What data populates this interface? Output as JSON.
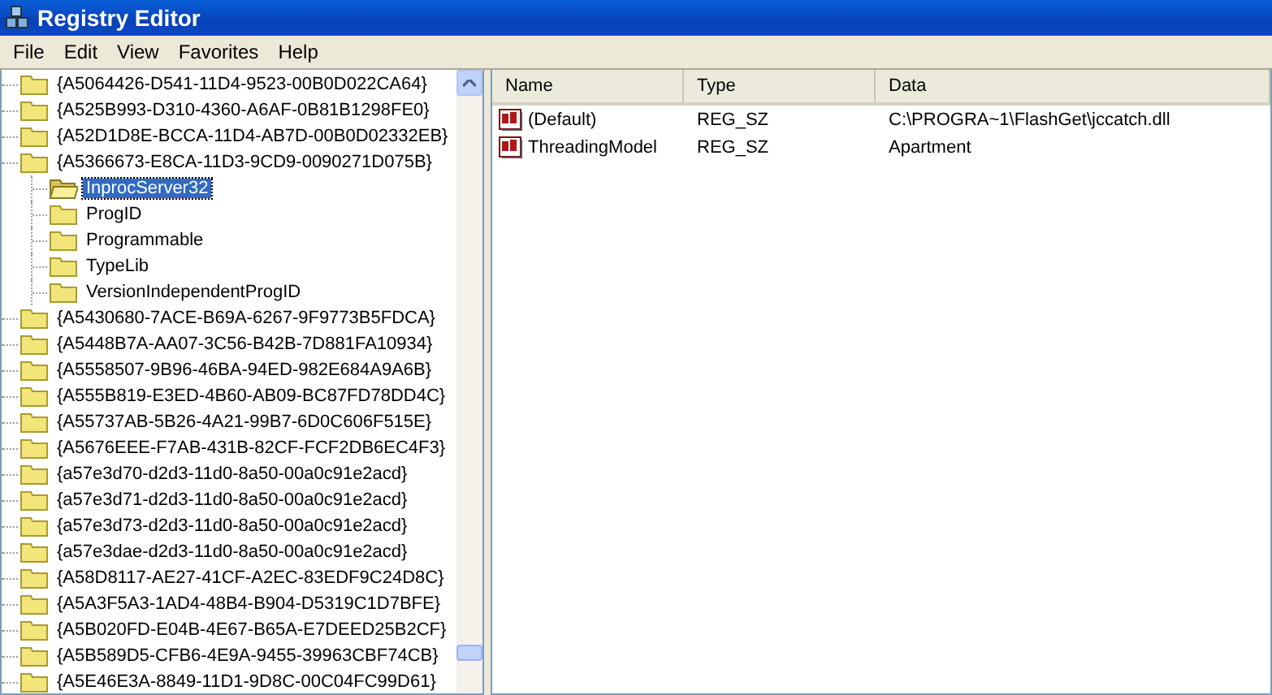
{
  "window": {
    "title": "Registry Editor"
  },
  "menu": [
    "File",
    "Edit",
    "View",
    "Favorites",
    "Help"
  ],
  "tree": [
    {
      "label": "{A5064426-D541-11D4-9523-00B0D022CA64}",
      "selected": false
    },
    {
      "label": "{A525B993-D310-4360-A6AF-0B81B1298FE0}",
      "selected": false
    },
    {
      "label": "{A52D1D8E-BCCA-11D4-AB7D-00B0D02332EB}",
      "selected": false
    },
    {
      "label": "{A5366673-E8CA-11D3-9CD9-0090271D075B}",
      "selected": false,
      "children": [
        {
          "label": "InprocServer32",
          "selected": true
        },
        {
          "label": "ProgID",
          "selected": false
        },
        {
          "label": "Programmable",
          "selected": false
        },
        {
          "label": "TypeLib",
          "selected": false
        },
        {
          "label": "VersionIndependentProgID",
          "selected": false
        }
      ]
    },
    {
      "label": "{A5430680-7ACE-B69A-6267-9F9773B5FDCA}",
      "selected": false
    },
    {
      "label": "{A5448B7A-AA07-3C56-B42B-7D881FA10934}",
      "selected": false
    },
    {
      "label": "{A5558507-9B96-46BA-94ED-982E684A9A6B}",
      "selected": false
    },
    {
      "label": "{A555B819-E3ED-4B60-AB09-BC87FD78DD4C}",
      "selected": false
    },
    {
      "label": "{A55737AB-5B26-4A21-99B7-6D0C606F515E}",
      "selected": false
    },
    {
      "label": "{A5676EEE-F7AB-431B-82CF-FCF2DB6EC4F3}",
      "selected": false
    },
    {
      "label": "{a57e3d70-d2d3-11d0-8a50-00a0c91e2acd}",
      "selected": false
    },
    {
      "label": "{a57e3d71-d2d3-11d0-8a50-00a0c91e2acd}",
      "selected": false
    },
    {
      "label": "{a57e3d73-d2d3-11d0-8a50-00a0c91e2acd}",
      "selected": false
    },
    {
      "label": "{a57e3dae-d2d3-11d0-8a50-00a0c91e2acd}",
      "selected": false
    },
    {
      "label": "{A58D8117-AE27-41CF-A2EC-83EDF9C24D8C}",
      "selected": false
    },
    {
      "label": "{A5A3F5A3-1AD4-48B4-B904-D5319C1D7BFE}",
      "selected": false
    },
    {
      "label": "{A5B020FD-E04B-4E67-B65A-E7DEED25B2CF}",
      "selected": false
    },
    {
      "label": "{A5B589D5-CFB6-4E9A-9455-39963CBF74CB}",
      "selected": false
    },
    {
      "label": "{A5E46E3A-8849-11D1-9D8C-00C04FC99D61}",
      "selected": false
    }
  ],
  "table": {
    "columns": [
      "Name",
      "Type",
      "Data"
    ],
    "rows": [
      {
        "name": "(Default)",
        "type": "REG_SZ",
        "data": "C:\\PROGRA~1\\FlashGet\\jccatch.dll"
      },
      {
        "name": "ThreadingModel",
        "type": "REG_SZ",
        "data": "Apartment"
      }
    ]
  }
}
